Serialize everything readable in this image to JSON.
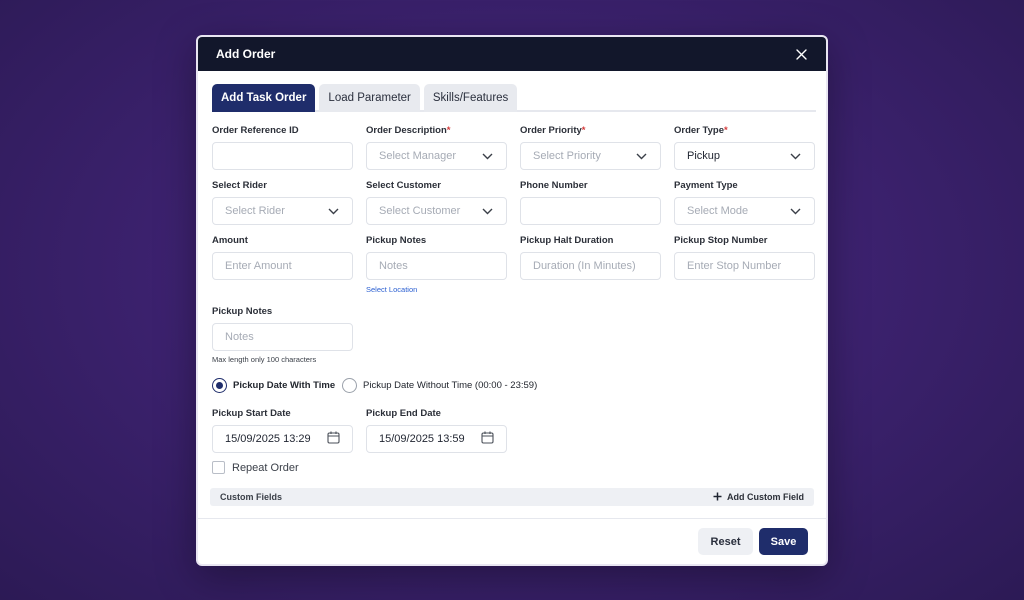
{
  "modal": {
    "title": "Add Order"
  },
  "tabs": [
    {
      "label": "Add Task Order",
      "active": true
    },
    {
      "label": "Load Parameter",
      "active": false
    },
    {
      "label": "Skills/Features",
      "active": false
    }
  ],
  "fields": {
    "order_reference_id": {
      "label": "Order Reference ID",
      "value": "",
      "placeholder": ""
    },
    "order_description": {
      "label": "Order Description",
      "required": "*",
      "placeholder": "Select Manager"
    },
    "order_priority": {
      "label": "Order Priority",
      "required": "*",
      "placeholder": "Select Priority"
    },
    "order_type": {
      "label": "Order Type",
      "required": "*",
      "value": "Pickup"
    },
    "select_rider": {
      "label": "Select Rider",
      "placeholder": "Select Rider"
    },
    "select_customer": {
      "label": "Select Customer",
      "placeholder": "Select Customer"
    },
    "phone_number": {
      "label": "Phone Number",
      "placeholder": ""
    },
    "payment_type": {
      "label": "Payment Type",
      "placeholder": "Select Mode"
    },
    "amount": {
      "label": "Amount",
      "placeholder": "Enter Amount"
    },
    "pickup_notes_1": {
      "label": "Pickup Notes",
      "placeholder": "Notes",
      "link": "Select Location"
    },
    "pickup_halt_duration": {
      "label": "Pickup Halt Duration",
      "placeholder": "Duration (In Minutes)"
    },
    "pickup_stop_number": {
      "label": "Pickup Stop Number",
      "placeholder": "Enter Stop Number"
    },
    "pickup_notes_2": {
      "label": "Pickup Notes",
      "placeholder": "Notes",
      "hint": "Max length only 100 characters"
    }
  },
  "radios": [
    {
      "label": "Pickup Date With Time",
      "checked": true
    },
    {
      "label": "Pickup Date Without Time (00:00 - 23:59)",
      "checked": false
    }
  ],
  "dates": {
    "start": {
      "label": "Pickup Start Date",
      "value": "15/09/2025 13:29"
    },
    "end": {
      "label": "Pickup End Date",
      "value": "15/09/2025 13:59"
    }
  },
  "repeat_order": {
    "label": "Repeat Order",
    "checked": false
  },
  "custom_fields": {
    "label": "Custom Fields",
    "add_label": "Add Custom Field"
  },
  "buttons": {
    "reset": "Reset",
    "save": "Save"
  },
  "colors": {
    "primary": "#1f2d6b",
    "header": "#12172b",
    "required": "#d43b3b",
    "link": "#2b5fd1"
  },
  "icons": {
    "close": "close-icon",
    "chevron": "chevron-down-icon",
    "calendar": "calendar-icon",
    "plus": "plus-icon"
  }
}
